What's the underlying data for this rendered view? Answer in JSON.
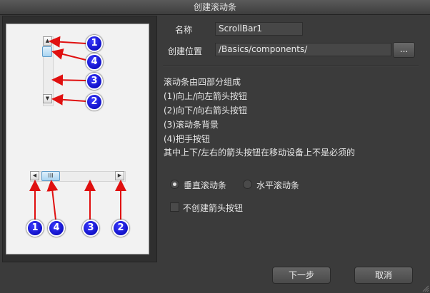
{
  "window": {
    "title": "创建滚动条"
  },
  "form": {
    "name_label": "名称",
    "name_value": "ScrollBar1",
    "location_label": "创建位置",
    "location_value": "/Basics/components/",
    "browse_label": "..."
  },
  "description": {
    "lines": [
      "滚动条由四部分组成",
      "(1)向上/向左箭头按钮",
      "(2)向下/向右箭头按钮",
      "(3)滚动条背景",
      "(4)把手按钮",
      "其中上下/左右的箭头按钮在移动设备上不是必须的"
    ]
  },
  "orientation": {
    "options": [
      {
        "label": "垂直滚动条",
        "selected": true
      },
      {
        "label": "水平滚动条",
        "selected": false
      }
    ]
  },
  "options": {
    "no_arrow_buttons_label": "不创建箭头按钮",
    "no_arrow_buttons_checked": false
  },
  "buttons": {
    "next_label": "下一步",
    "cancel_label": "取消"
  },
  "preview": {
    "callouts": [
      "1",
      "4",
      "3",
      "2",
      "1",
      "4",
      "3",
      "2"
    ],
    "up_glyph": "▲",
    "down_glyph": "▼",
    "left_glyph": "◀",
    "right_glyph": "▶",
    "grip_glyph": "III"
  },
  "colors": {
    "callout": "#1010d0",
    "arrow": "#e01010",
    "background": "#3b3b3b"
  }
}
